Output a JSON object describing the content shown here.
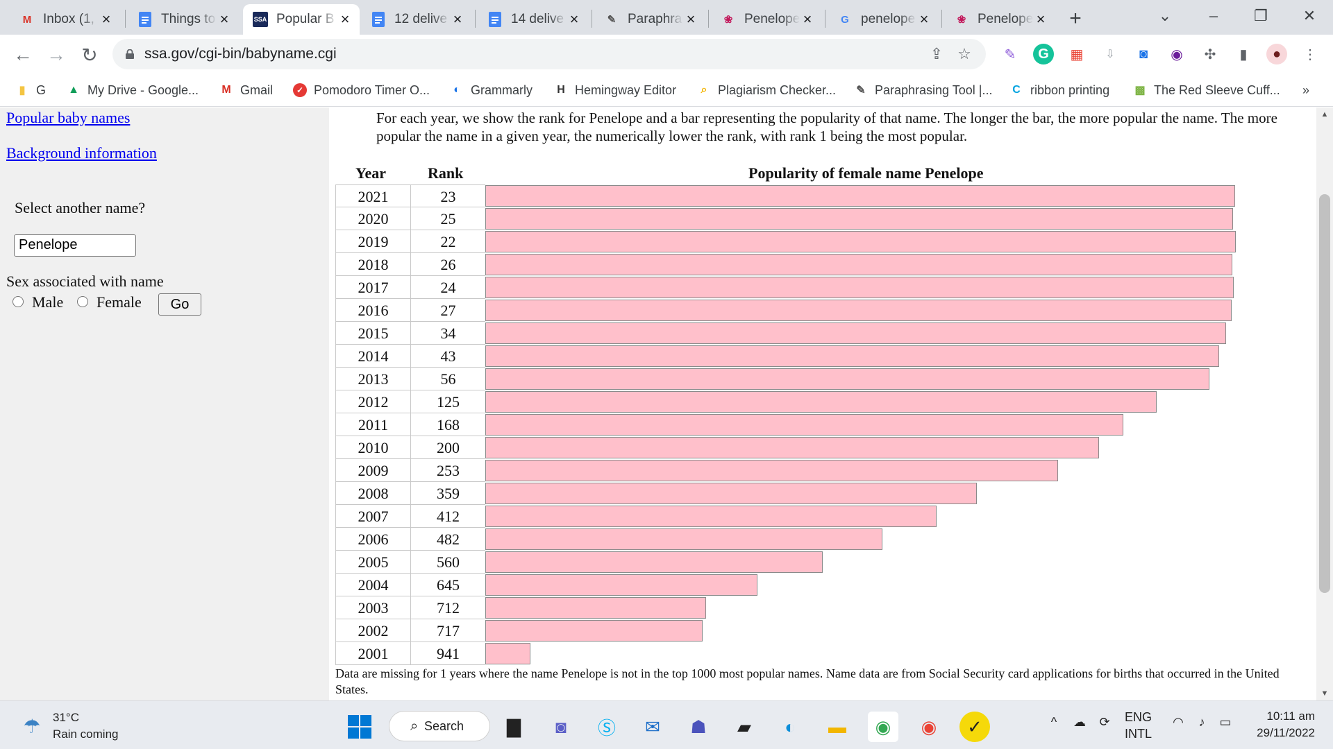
{
  "browser": {
    "tabs": [
      {
        "title": "Inbox (1,",
        "icon": "gmail-icon",
        "active": false
      },
      {
        "title": "Things to",
        "icon": "docs-icon",
        "active": false
      },
      {
        "title": "Popular B",
        "icon": "ssa-icon",
        "active": true
      },
      {
        "title": "12 delive",
        "icon": "docs-icon",
        "active": false
      },
      {
        "title": "14 delive",
        "icon": "docs-icon",
        "active": false
      },
      {
        "title": "Paraphra",
        "icon": "quill-icon",
        "active": false
      },
      {
        "title": "Penelope",
        "icon": "flower-icon",
        "active": false
      },
      {
        "title": "penelope",
        "icon": "google-icon",
        "active": false
      },
      {
        "title": "Penelope",
        "icon": "flower-icon",
        "active": false
      }
    ],
    "url": "ssa.gov/cgi-bin/babyname.cgi",
    "bookmarks": [
      {
        "label": "G",
        "icon": "folder-icon"
      },
      {
        "label": "My Drive - Google...",
        "icon": "drive-icon"
      },
      {
        "label": "Gmail",
        "icon": "gmail-icon"
      },
      {
        "label": "Pomodoro Timer O...",
        "icon": "pomodoro-icon"
      },
      {
        "label": "Grammarly",
        "icon": "grammarly-icon"
      },
      {
        "label": "Hemingway Editor",
        "icon": "hemingway-icon"
      },
      {
        "label": "Plagiarism Checker...",
        "icon": "magnifier-icon"
      },
      {
        "label": "Paraphrasing Tool |...",
        "icon": "quill-icon"
      },
      {
        "label": "ribbon printing",
        "icon": "c-icon"
      },
      {
        "label": "The Red Sleeve Cuff...",
        "icon": "bookmark-image-icon"
      }
    ],
    "bookmarks_more": "»"
  },
  "sidebar": {
    "link_popular": "Popular baby names",
    "link_background": "Background information",
    "select_label": "Select another name?",
    "name_value": "Penelope",
    "sex_label": "Sex associated with name",
    "male_label": "Male",
    "female_label": "Female",
    "go_label": "Go"
  },
  "main": {
    "intro": "For each year, we show the rank for Penelope and a bar representing the popularity of that name. The longer the bar, the more popular the name. The more popular the name in a given year, the numerically lower the rank, with rank 1 being the most popular.",
    "col_year": "Year",
    "col_rank": "Rank",
    "col_bar": "Popularity of female name Penelope",
    "footnote": "Data are missing for 1 years where the name Penelope is not in the top 1000 most popular names. Name data are from Social Security card applications for births that occurred in the United States."
  },
  "chart_data": {
    "type": "bar",
    "categories": [
      "2021",
      "2020",
      "2019",
      "2018",
      "2017",
      "2016",
      "2015",
      "2014",
      "2013",
      "2012",
      "2011",
      "2010",
      "2009",
      "2008",
      "2007",
      "2006",
      "2005",
      "2004",
      "2003",
      "2002",
      "2001"
    ],
    "values": [
      23,
      25,
      22,
      26,
      24,
      27,
      34,
      43,
      56,
      125,
      168,
      200,
      253,
      359,
      412,
      482,
      560,
      645,
      712,
      717,
      941
    ],
    "ylabel": "Rank",
    "title": "Popularity of female name Penelope"
  },
  "taskbar": {
    "temp": "31°C",
    "weather": "Rain coming",
    "search": "Search",
    "lang1": "ENG",
    "lang2": "INTL",
    "time": "10:11 am",
    "date": "29/11/2022"
  }
}
